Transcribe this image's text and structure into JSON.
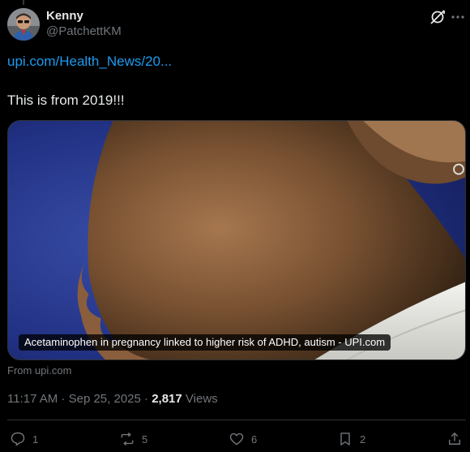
{
  "author": {
    "display_name": "Kenny",
    "handle": "@PatchettKM"
  },
  "tweet": {
    "link_text": "upi.com/Health_News/20...",
    "text": "This is from 2019!!!"
  },
  "card": {
    "title": "Acetaminophen in pregnancy linked to higher risk of ADHD, autism - UPI.com",
    "source": "From upi.com"
  },
  "meta": {
    "time": "11:17 AM",
    "date": "Sep 25, 2025",
    "views_count": "2,817",
    "views_label": "Views"
  },
  "actions": {
    "replies": "1",
    "reposts": "5",
    "likes": "6",
    "bookmarks": "2"
  },
  "colors": {
    "background": "#000000",
    "link": "#1d9bf0",
    "primary_text": "#e7e9ea",
    "secondary_text": "#71767b",
    "divider": "#2f3336"
  },
  "icons": [
    "grok-icon",
    "more-icon",
    "reply-icon",
    "repost-icon",
    "like-icon",
    "bookmark-icon",
    "share-icon"
  ]
}
